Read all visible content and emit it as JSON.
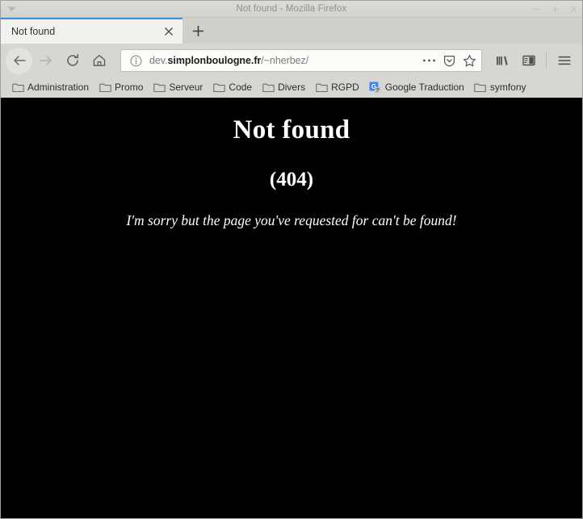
{
  "window": {
    "title": "Not found - Mozilla Firefox",
    "menu_arrow_icon": "chevron-down-icon",
    "controls": [
      {
        "name": "minimize-button",
        "icon": "minimize-icon",
        "label": "−"
      },
      {
        "name": "maximize-button",
        "icon": "maximize-icon",
        "label": "+"
      },
      {
        "name": "close-button",
        "icon": "close-icon",
        "label": "×"
      }
    ]
  },
  "tabs": {
    "items": [
      {
        "label": "Not found",
        "active": true,
        "close_icon": "close-icon"
      }
    ],
    "new_tab_label": "+",
    "new_tab_icon": "plus-icon",
    "active_indicator_color": "#3a8fe0"
  },
  "toolbar": {
    "back_icon": "back-arrow-icon",
    "forward_icon": "forward-arrow-icon",
    "reload_icon": "reload-icon",
    "home_icon": "home-icon",
    "library_icon": "library-icon",
    "sidebar_icon": "sidebar-icon",
    "menu_icon": "hamburger-menu-icon"
  },
  "urlbar": {
    "identity_icon": "info-circle-icon",
    "value": "dev.simplonboulogne.fr/~nherbez/",
    "prefix": "dev.",
    "host": "simplonboulogne.fr",
    "path": "/~nherbez/",
    "page_actions_icon": "ellipsis-icon",
    "tracking_protection_icon": "shield-icon",
    "bookmark_icon": "star-icon"
  },
  "bookmarks": {
    "items": [
      {
        "label": "Administration",
        "icon": "folder-icon"
      },
      {
        "label": "Promo",
        "icon": "folder-icon"
      },
      {
        "label": "Serveur",
        "icon": "folder-icon"
      },
      {
        "label": "Code",
        "icon": "folder-icon"
      },
      {
        "label": "Divers",
        "icon": "folder-icon"
      },
      {
        "label": "RGPD",
        "icon": "folder-icon"
      },
      {
        "label": "Google Traduction",
        "icon": "google-translate-favicon"
      },
      {
        "label": "symfony",
        "icon": "folder-icon"
      }
    ]
  },
  "page": {
    "background_color": "#000000",
    "text_color": "#ffffff",
    "title": "Not found",
    "code": "(404)",
    "message": "I'm sorry but the page you've requested for can't be found!"
  }
}
